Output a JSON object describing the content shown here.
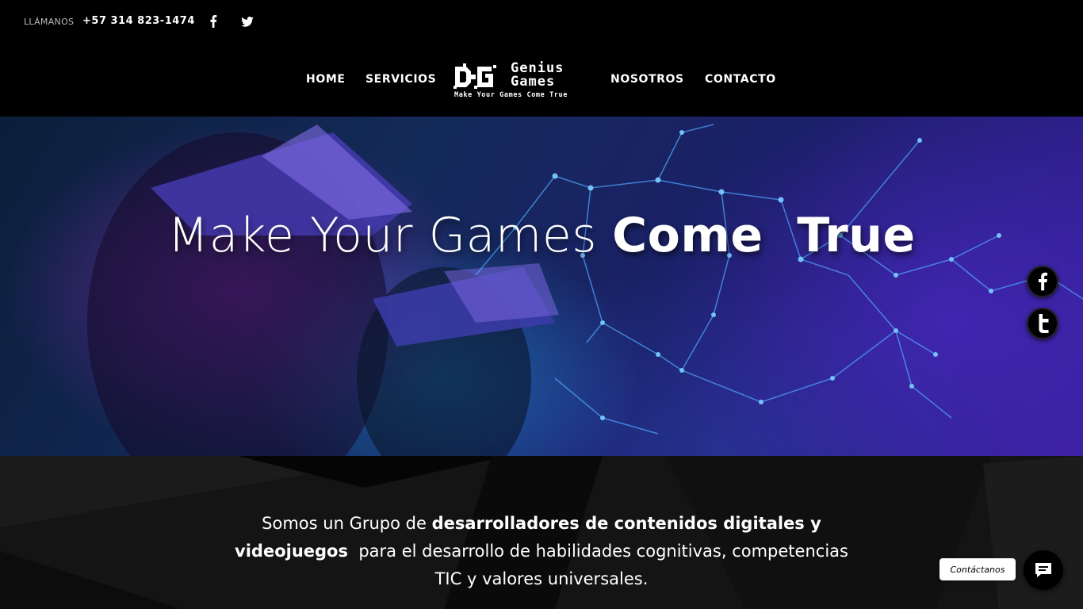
{
  "topbar": {
    "call_label": "LLÁMANOS",
    "phone": "+57 314 823-1474",
    "social": [
      {
        "icon": "facebook-icon"
      },
      {
        "icon": "twitter-icon"
      }
    ]
  },
  "nav": {
    "items": [
      {
        "label": "HOME"
      },
      {
        "label": "SERVICIOS"
      },
      {
        "label": "NOSOTROS"
      },
      {
        "label": "CONTACTO"
      }
    ],
    "logo": {
      "line1": "Genius",
      "line2": "Games",
      "tagline": "Make Your Games Come True"
    }
  },
  "hero": {
    "heading_light": "Make Your Games",
    "heading_bold": "Come  True",
    "floating_social": [
      {
        "icon": "facebook-icon"
      },
      {
        "icon": "twitter-icon"
      }
    ]
  },
  "about": {
    "part1": "Somos un Grupo de ",
    "bold1": "desarrolladores de contenidos digitales y videojuegos",
    "part2": "  para el desarrollo de habilidades cognitivas, competencias TIC y valores universales."
  },
  "chat": {
    "label": "Contáctanos",
    "icon": "chat-bubble-icon"
  },
  "colors": {
    "background": "#000000",
    "text": "#ffffff",
    "hero_accent_purple": "#3a1fa0",
    "hero_accent_cyan": "#1e96dc"
  }
}
